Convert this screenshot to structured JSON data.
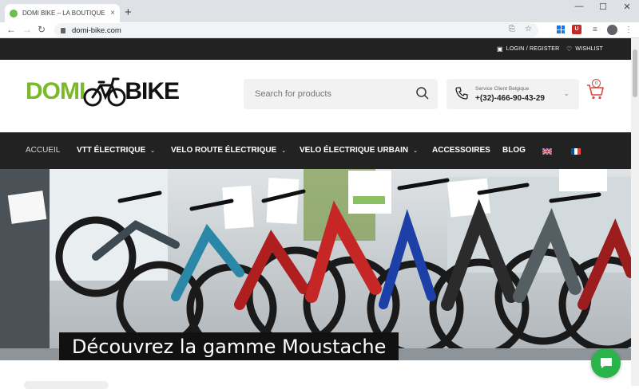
{
  "browser": {
    "tab_title": "DOMI BIKE – LA BOUTIQUE DE VÉLO",
    "url": "domi-bike.com",
    "new_tab_label": "+",
    "close_label": "×"
  },
  "topbar": {
    "login_label": "LOGIN / REGISTER",
    "wishlist_label": "WISHLIST"
  },
  "logo": {
    "part1": "DOMI",
    "part2": "BIKE"
  },
  "search": {
    "placeholder": "Search for products"
  },
  "support": {
    "label": "Service Client Belgique",
    "phone": "+(32)-466-90-43-29"
  },
  "cart": {
    "count": "0"
  },
  "nav": {
    "items": [
      {
        "label": "ACCUEIL"
      },
      {
        "label": "VTT ÉLECTRIQUE"
      },
      {
        "label": "VELO ROUTE ÉLECTRIQUE"
      },
      {
        "label": "VELO ÉLECTRIQUE URBAIN"
      },
      {
        "label": "ACCESSOIRES"
      },
      {
        "label": "BLOG"
      }
    ]
  },
  "hero": {
    "caption": "Découvrez la gamme Moustache"
  },
  "colors": {
    "brand_green": "#7ab929",
    "dark_bar": "#222222",
    "cart_red": "#e0443e",
    "chat_green": "#29b34a"
  }
}
